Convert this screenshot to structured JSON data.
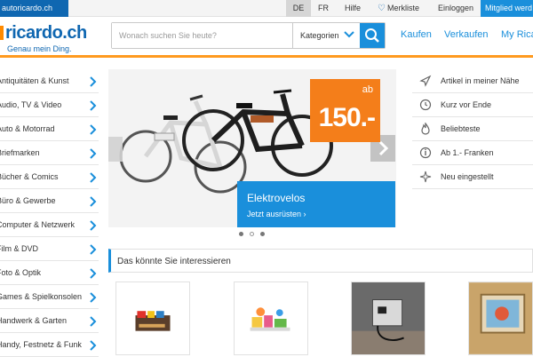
{
  "topbar": {
    "motor_tab": "autoricardo.ch",
    "lang_de": "DE",
    "lang_fr": "FR",
    "help": "Hilfe",
    "watchlist": "Merkliste",
    "login": "Einloggen",
    "member": "Mitglied werd"
  },
  "header": {
    "logo_text": "ricardo.ch",
    "logo_tagline": "Genau mein Ding.",
    "search_placeholder": "Wonach suchen Sie heute?",
    "category_select": "Kategorien",
    "nav": [
      "Kaufen",
      "Verkaufen",
      "My Ricar"
    ]
  },
  "sidebar": {
    "items": [
      "Antiquitäten & Kunst",
      "Audio, TV & Video",
      "Auto & Motorrad",
      "Briefmarken",
      "Bücher & Comics",
      "Büro & Gewerbe",
      "Computer & Netzwerk",
      "Film & DVD",
      "Foto & Optik",
      "Games & Spielkonsolen",
      "Handwerk & Garten",
      "Handy, Festnetz & Funk"
    ]
  },
  "hero": {
    "badge_prefix": "ab",
    "badge_price": "150.-",
    "promo_title": "Elektrovelos",
    "promo_link": "Jetzt ausrüsten ›"
  },
  "right_list": {
    "items": [
      {
        "label": "Artikel in meiner Nähe",
        "icon": "location-icon"
      },
      {
        "label": "Kurz vor Ende",
        "icon": "timer-icon"
      },
      {
        "label": "Beliebteste",
        "icon": "flame-icon"
      },
      {
        "label": "Ab 1.- Franken",
        "icon": "info-icon"
      },
      {
        "label": "Neu eingestellt",
        "icon": "sparkle-icon"
      }
    ]
  },
  "section": {
    "title": "Das könnte Sie interessieren"
  },
  "colors": {
    "brand_blue": "#0f67b1",
    "accent_blue": "#1a8fdb",
    "accent_orange": "#f47e1a"
  }
}
